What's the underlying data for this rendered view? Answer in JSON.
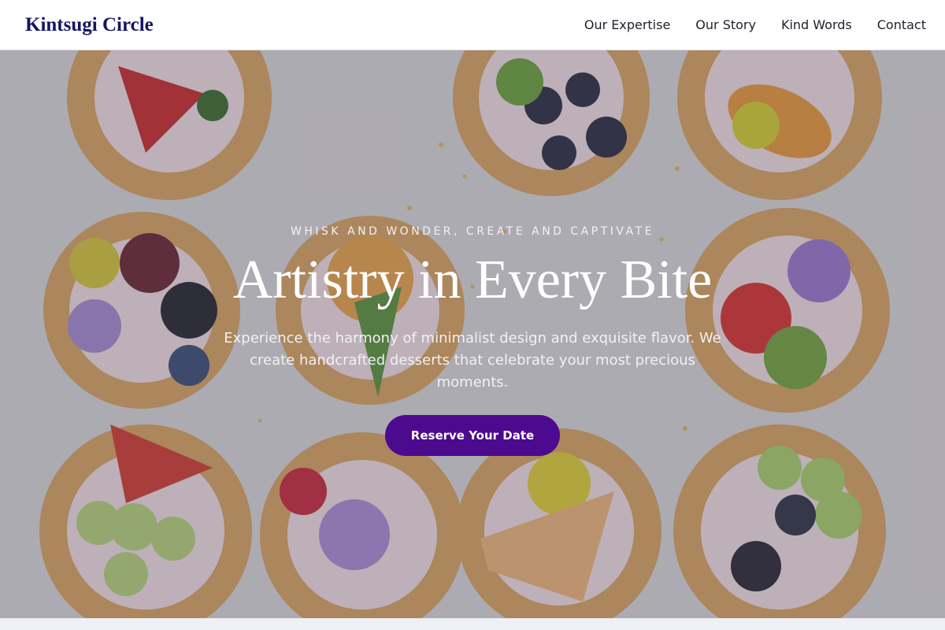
{
  "header": {
    "brand": "Kintsugi Circle",
    "nav": [
      "Our Expertise",
      "Our Story",
      "Kind Words",
      "Contact"
    ]
  },
  "hero": {
    "tagline": "WHISK AND WONDER, CREATE AND CAPTIVATE",
    "title": "Artistry in Every Bite",
    "subtitle": "Experience the harmony of minimalist design and exquisite flavor. We create handcrafted desserts that celebrate your most precious moments.",
    "cta_label": "Reserve Your Date"
  },
  "colors": {
    "brand": "#141466",
    "cta": "#4c0a8f",
    "header_bg": "#ffffff"
  }
}
